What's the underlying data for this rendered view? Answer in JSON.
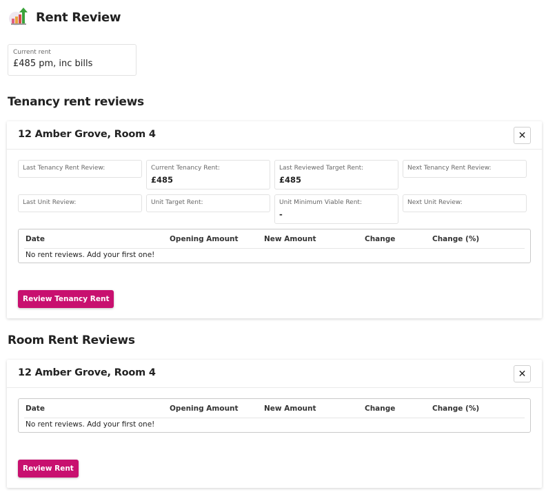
{
  "page": {
    "title": "Rent Review",
    "logo_icon": "rent-review-chart-icon"
  },
  "current_rent": {
    "label": "Current rent",
    "value": "£485 pm, inc bills"
  },
  "tenancy_section": {
    "heading": "Tenancy rent reviews",
    "card": {
      "title": "12 Amber Grove, Room 4",
      "close_icon": "close-icon",
      "stats": [
        {
          "label": "Last Tenancy Rent Review:",
          "value": ""
        },
        {
          "label": "Current Tenancy Rent:",
          "value": "£485"
        },
        {
          "label": "Last Reviewed Target Rent:",
          "value": "£485"
        },
        {
          "label": "Next Tenancy Rent Review:",
          "value": ""
        },
        {
          "label": "Last Unit Review:",
          "value": ""
        },
        {
          "label": "Unit Target Rent:",
          "value": ""
        },
        {
          "label": "Unit Minimum Viable Rent:",
          "value": "-"
        },
        {
          "label": "Next Unit Review:",
          "value": ""
        }
      ],
      "table": {
        "columns": [
          "Date",
          "Opening Amount",
          "New Amount",
          "Change",
          "Change (%)"
        ],
        "empty_message": "No rent reviews. Add your first one!"
      },
      "button_label": "Review Tenancy Rent"
    }
  },
  "room_section": {
    "heading": "Room Rent Reviews",
    "card": {
      "title": "12 Amber Grove, Room 4",
      "close_icon": "close-icon",
      "table": {
        "columns": [
          "Date",
          "Opening Amount",
          "New Amount",
          "Change",
          "Change (%)"
        ],
        "empty_message": "No rent reviews. Add your first one!"
      },
      "button_label": "Review Rent"
    }
  },
  "colors": {
    "primary_button": "#c8106f",
    "arrow_green": "#3aa23a"
  }
}
